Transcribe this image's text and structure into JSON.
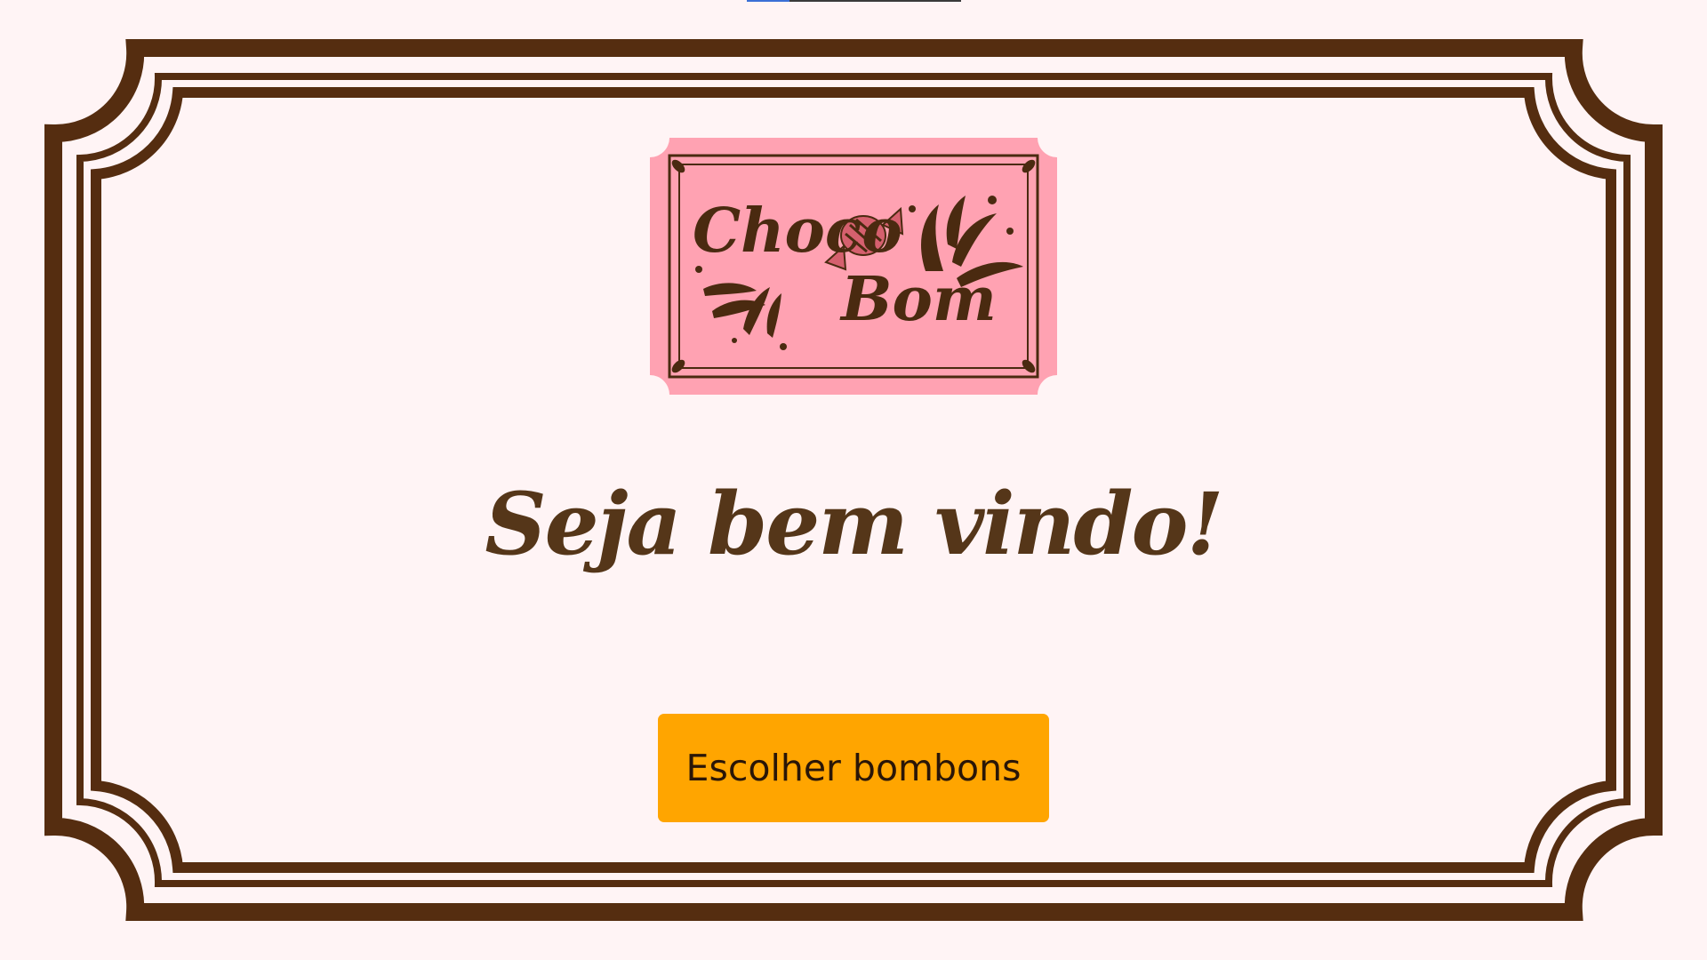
{
  "colors": {
    "page_background": "#fff4f5",
    "frame_brown": "#552d10",
    "logo_pink": "#ffa2b2",
    "logo_brown": "#4a2a10",
    "heading_brown": "#553619",
    "button_orange": "#ffa500",
    "button_text": "#2a1607"
  },
  "logo": {
    "line1": "Choco",
    "line2": "Bom"
  },
  "heading": "Seja bem vindo!",
  "button": {
    "label": "Escolher bombons"
  }
}
